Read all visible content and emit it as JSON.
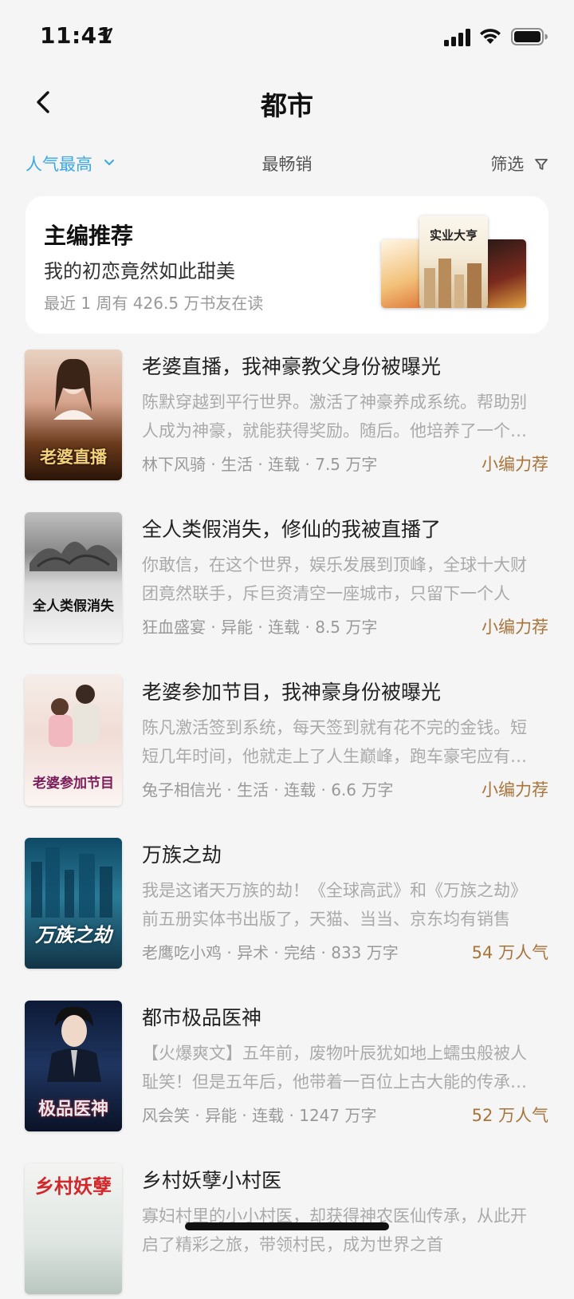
{
  "status_bar": {
    "time": "11:41"
  },
  "header": {
    "title": "都市"
  },
  "sort_bar": {
    "popular": "人气最高",
    "bestseller": "最畅销",
    "filter": "筛选"
  },
  "editor_pick": {
    "heading": "主编推荐",
    "book": "我的初恋竟然如此甜美",
    "stats": "最近 1 周有 426.5 万书友在读",
    "cover_center_title": "实业大亨"
  },
  "books": [
    {
      "title": "老婆直播，我神豪教父身份被曝光",
      "desc": "陈默穿越到平行世界。激活了神豪养成系统。帮助别人成为神豪，就能获得奖励。随后。他培养了一个又一个神豪",
      "meta": "林下风骑 · 生活 · 连载 · 7.5 万字",
      "tag": "小编力荐",
      "cover_text": "老婆直播"
    },
    {
      "title": "全人类假消失，修仙的我被直播了",
      "desc": "你敢信，在这个世界，娱乐发展到顶峰，全球十大财团竟然联手，斥巨资清空一座城市，只留下一个人",
      "meta": "狂血盛宴 · 异能 · 连载 · 8.5 万字",
      "tag": "小编力荐",
      "cover_text": "全人类假消失"
    },
    {
      "title": "老婆参加节目，我神豪身份被曝光",
      "desc": "陈凡激活签到系统，每天签到就有花不完的金钱。短短几年时间，他就走上了人生巅峰，跑车豪宅应有尽有",
      "meta": "兔子相信光 · 生活 · 连载 · 6.6 万字",
      "tag": "小编力荐",
      "cover_text": "老婆参加节目"
    },
    {
      "title": "万族之劫",
      "desc": "我是这诸天万族的劫！《全球高武》和《万族之劫》前五册实体书出版了，天猫、当当、京东均有销售",
      "meta": "老鹰吃小鸡 · 异术 · 完结 · 833 万字",
      "tag": "54 万人气",
      "cover_text": "万族之劫"
    },
    {
      "title": "都市极品医神",
      "desc": "【火爆爽文】五年前，废物叶辰犹如地上蠕虫般被人耻笑！但是五年后，他带着一百位上古大能的传承归来",
      "meta": "风会笑 · 异能 · 连载 · 1247 万字",
      "tag": "52 万人气",
      "cover_text": "极品医神"
    },
    {
      "title": "乡村妖孽小村医",
      "desc": "寡妇村里的小小村医，却获得神农医仙传承，从此开启了精彩之旅，带领村民，成为世界之首",
      "meta": "",
      "tag": "",
      "cover_text": "乡村妖孽"
    }
  ]
}
